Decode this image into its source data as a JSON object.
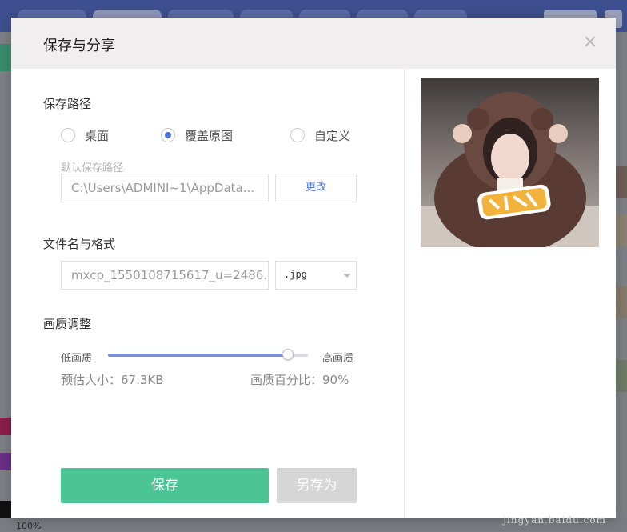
{
  "dialog": {
    "title": "保存与分享",
    "close_icon": "close-icon"
  },
  "save_path": {
    "section_title": "保存路径",
    "options": [
      {
        "label": "桌面",
        "checked": false
      },
      {
        "label": "覆盖原图",
        "checked": true
      },
      {
        "label": "自定义",
        "checked": false
      }
    ],
    "hint": "默认保存路径",
    "path_value": "C:\\Users\\ADMINI~1\\AppData...",
    "change_label": "更改"
  },
  "filename": {
    "section_title": "文件名与格式",
    "name_value": "mxcp_1550108715617_u=2486...",
    "format_value": ".jpg"
  },
  "quality": {
    "section_title": "画质调整",
    "low_label": "低画质",
    "high_label": "高画质",
    "value_fraction": 0.9,
    "estimated_size": "预估大小：67.3KB",
    "percent_text": "画质百分比：90%"
  },
  "actions": {
    "save_label": "保存",
    "save_as_label": "另存为"
  },
  "background_app": {
    "zoom_label": "100%"
  },
  "watermark": {
    "text": "jingyan.baidu.com"
  },
  "colors": {
    "primary_green": "#4cc596",
    "accent_blue": "#4f74d9",
    "slider_fill": "#7b8fd6"
  }
}
